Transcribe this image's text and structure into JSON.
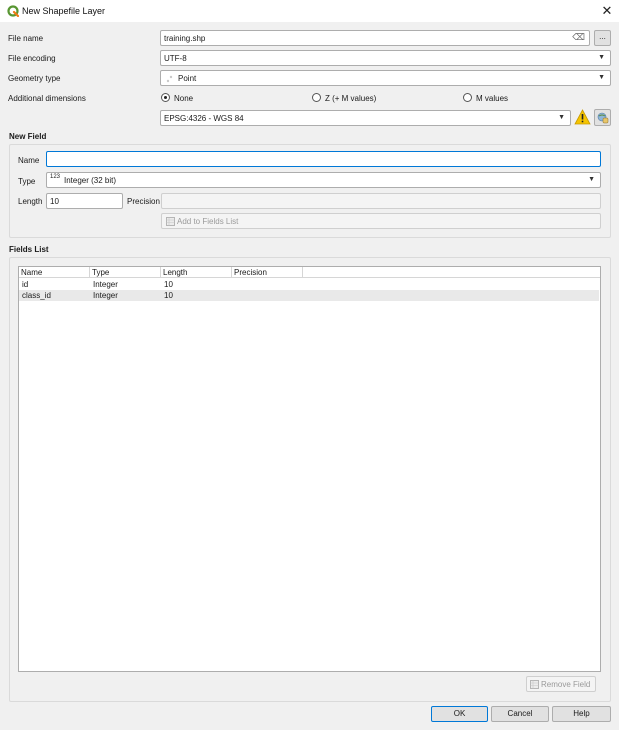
{
  "window": {
    "title": "New Shapefile Layer",
    "close_glyph": "✕",
    "logo_icon": "qgis-logo"
  },
  "form": {
    "file_name": {
      "label": "File name",
      "value": "training.shp",
      "clear_glyph": "⌫",
      "browse_label": "..."
    },
    "file_encoding": {
      "label": "File encoding",
      "value": "UTF-8"
    },
    "geometry_type": {
      "label": "Geometry type",
      "value": "Point",
      "icon": "point-geometry-icon"
    },
    "additional_dimensions": {
      "label": "Additional dimensions",
      "options": [
        {
          "label": "None",
          "selected": true
        },
        {
          "label": "Z (+ M values)",
          "selected": false
        },
        {
          "label": "M values",
          "selected": false
        }
      ]
    },
    "crs": {
      "value": "EPSG:4326 - WGS 84",
      "warning_icon": "warning-icon",
      "selector_icon": "crs-selector-icon"
    }
  },
  "new_field": {
    "title": "New Field",
    "name_label": "Name",
    "name_value": "",
    "type_label": "Type",
    "type_prefix": "123",
    "type_value": "Integer (32 bit)",
    "length_label": "Length",
    "length_value": "10",
    "precision_label": "Precision",
    "precision_value": "",
    "add_button": "Add to Fields List"
  },
  "fields_list": {
    "title": "Fields List",
    "columns": [
      "Name",
      "Type",
      "Length",
      "Precision"
    ],
    "rows": [
      {
        "name": "id",
        "type": "Integer",
        "length": "10",
        "precision": ""
      },
      {
        "name": "class_id",
        "type": "Integer",
        "length": "10",
        "precision": ""
      }
    ],
    "remove_button": "Remove Field"
  },
  "buttons": {
    "ok": "OK",
    "cancel": "Cancel",
    "help": "Help"
  },
  "colors": {
    "accent": "#0078d7",
    "warning": "#f5c400",
    "qgis_green": "#589632",
    "qgis_yellow": "#ee7913"
  }
}
